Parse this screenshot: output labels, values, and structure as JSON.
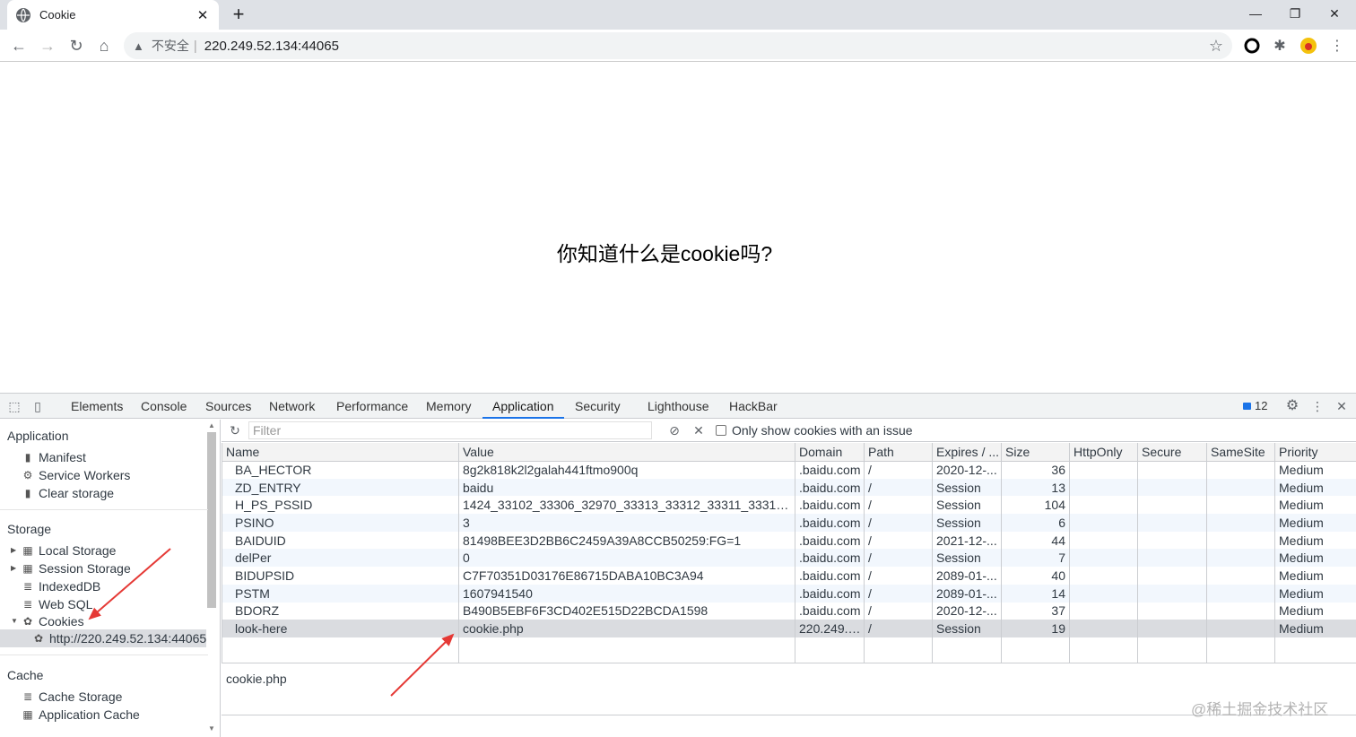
{
  "browser": {
    "tab_title": "Cookie",
    "tab_close": "✕",
    "new_tab": "+",
    "window_controls": {
      "minimize": "—",
      "restore": "❐",
      "close": "✕"
    },
    "address": {
      "insecure_label": "不安全",
      "separator": "|",
      "url": "220.249.52.134:44065"
    }
  },
  "page": {
    "heading": "你知道什么是cookie吗?"
  },
  "devtools": {
    "tabs": [
      "Elements",
      "Console",
      "Sources",
      "Network",
      "Performance",
      "Memory",
      "Application",
      "Security",
      "Lighthouse",
      "HackBar"
    ],
    "active_tab": "Application",
    "issues_count": "12",
    "sidebar": {
      "application_header": "Application",
      "application_items": [
        "Manifest",
        "Service Workers",
        "Clear storage"
      ],
      "storage_header": "Storage",
      "storage_items": [
        "Local Storage",
        "Session Storage",
        "IndexedDB",
        "Web SQL",
        "Cookies"
      ],
      "cookie_origin": "http://220.249.52.134:44065",
      "cache_header": "Cache",
      "cache_items": [
        "Cache Storage",
        "Application Cache"
      ]
    },
    "cookies": {
      "filter_placeholder": "Filter",
      "only_issue_label": "Only show cookies with an issue",
      "columns": [
        "Name",
        "Value",
        "Domain",
        "Path",
        "Expires / ...",
        "Size",
        "HttpOnly",
        "Secure",
        "SameSite",
        "Priority"
      ],
      "rows": [
        [
          "BA_HECTOR",
          "8g2k818k2l2galah441ftmo900q",
          ".baidu.com",
          "/",
          "2020-12-...",
          "36",
          "",
          "",
          "",
          "Medium"
        ],
        [
          "ZD_ENTRY",
          "baidu",
          ".baidu.com",
          "/",
          "Session",
          "13",
          "",
          "",
          "",
          "Medium"
        ],
        [
          "H_PS_PSSID",
          "1424_33102_33306_32970_33313_33312_33311_33310_33...",
          ".baidu.com",
          "/",
          "Session",
          "104",
          "",
          "",
          "",
          "Medium"
        ],
        [
          "PSINO",
          "3",
          ".baidu.com",
          "/",
          "Session",
          "6",
          "",
          "",
          "",
          "Medium"
        ],
        [
          "BAIDUID",
          "81498BEE3D2BB6C2459A39A8CCB50259:FG=1",
          ".baidu.com",
          "/",
          "2021-12-...",
          "44",
          "",
          "",
          "",
          "Medium"
        ],
        [
          "delPer",
          "0",
          ".baidu.com",
          "/",
          "Session",
          "7",
          "",
          "",
          "",
          "Medium"
        ],
        [
          "BIDUPSID",
          "C7F70351D03176E86715DABA10BC3A94",
          ".baidu.com",
          "/",
          "2089-01-...",
          "40",
          "",
          "",
          "",
          "Medium"
        ],
        [
          "PSTM",
          "1607941540",
          ".baidu.com",
          "/",
          "2089-01-...",
          "14",
          "",
          "",
          "",
          "Medium"
        ],
        [
          "BDORZ",
          "B490B5EBF6F3CD402E515D22BCDA1598",
          ".baidu.com",
          "/",
          "2020-12-...",
          "37",
          "",
          "",
          "",
          "Medium"
        ],
        [
          "look-here",
          "cookie.php",
          "220.249.5...",
          "/",
          "Session",
          "19",
          "",
          "",
          "",
          "Medium"
        ]
      ],
      "selected_row": 9,
      "preview_value": "cookie.php"
    }
  },
  "watermark": "@稀土掘金技术社区",
  "colors": {
    "accent": "#1a73e8",
    "annotation": "#e53935",
    "selected_row": "#dadce0"
  }
}
